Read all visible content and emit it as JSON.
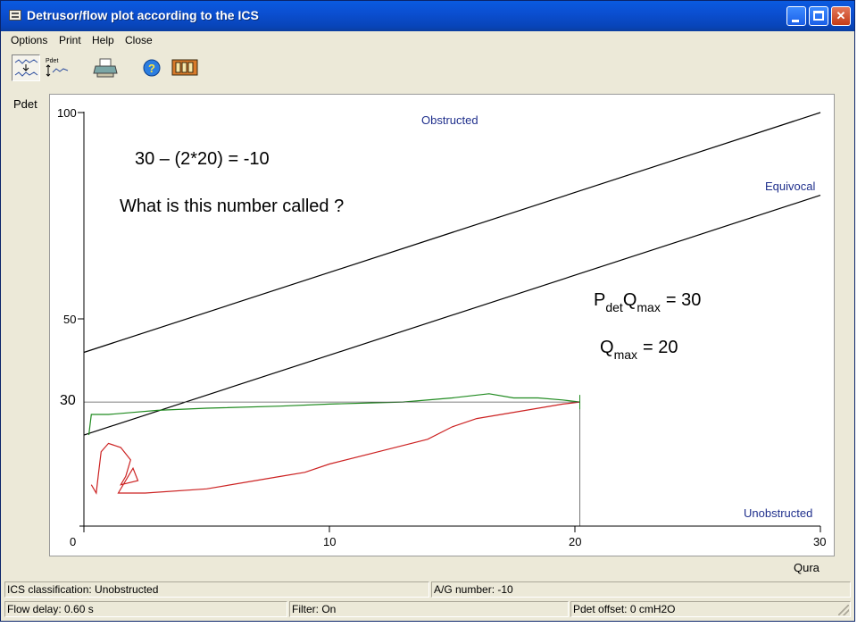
{
  "window": {
    "title": "Detrusor/flow plot according to the ICS"
  },
  "menu": [
    "Options",
    "Print",
    "Help",
    "Close"
  ],
  "toolbar": {
    "tools": [
      "plot-view-icon",
      "pdet-view-icon",
      "printer-icon",
      "help-icon",
      "film-icon"
    ]
  },
  "plot": {
    "y_axis_label": "Pdet",
    "x_axis_label": "Qura",
    "y_ticks": [
      "100",
      "50",
      "30"
    ],
    "x_ticks": [
      "0",
      "10",
      "20",
      "30"
    ],
    "zone_labels": {
      "obstructed": "Obstructed",
      "equivocal": "Equivocal",
      "unobstructed": "Unobstructed"
    },
    "annotations": {
      "formula": "30 – (2*20) = -10",
      "question": "What is this number called ?",
      "pdetqmax_p": "P",
      "pdetqmax_det": "det",
      "pdetqmax_q": "Q",
      "pdetqmax_max": "max",
      "pdetqmax_value": "= 30",
      "qmax_q": "Q",
      "qmax_max": "max",
      "qmax_value": "= 20"
    },
    "colors": {
      "axis": "#000000",
      "boundary_lines": "#000000",
      "zone_label": "#1f2f8c",
      "voiding_curve": "#cc2222",
      "filling_curve": "#1f8a1f"
    }
  },
  "chart_data": {
    "type": "line",
    "xlabel": "Qura",
    "ylabel": "Pdet",
    "xlim": [
      0,
      30
    ],
    "ylim": [
      0,
      100
    ],
    "x_ticks": [
      0,
      10,
      20,
      30
    ],
    "y_ticks": [
      50,
      100
    ],
    "series": [
      {
        "x": [
          0,
          30
        ],
        "y": [
          42,
          100
        ]
      },
      {
        "x": [
          0,
          30
        ],
        "y": [
          22,
          80
        ]
      },
      {
        "x": [
          0.2,
          0.3,
          0.5,
          1,
          2,
          3,
          5,
          8,
          10,
          13,
          15,
          16.5,
          17.5,
          18.5,
          19.5,
          20.2
        ],
        "y": [
          22,
          27,
          27,
          27,
          27.5,
          28,
          28.5,
          29,
          29.5,
          30,
          31,
          32,
          31,
          31,
          30.5,
          30
        ]
      },
      {
        "x": [
          0.3,
          0.5,
          0.6,
          0.7,
          1,
          1.5,
          1.9,
          1.7,
          1.5,
          2.2,
          2.0,
          1.4,
          2.5,
          5,
          8,
          9,
          10,
          12,
          14,
          15,
          16,
          18,
          19.5,
          20.2
        ],
        "y": [
          10,
          8,
          13,
          18,
          20,
          19,
          16,
          12,
          10,
          11,
          14,
          8,
          8,
          9,
          12,
          13,
          15,
          18,
          21,
          24,
          26,
          28,
          29.5,
          30
        ]
      },
      {
        "x": [
          0,
          20.2
        ],
        "y": [
          30,
          30
        ]
      },
      {
        "x": [
          20.2,
          20.2
        ],
        "y": [
          0,
          30
        ]
      }
    ]
  },
  "status": {
    "classification": "ICS classification: Unobstructed",
    "ag_number": "A/G number: -10",
    "flow_delay": "Flow delay: 0.60 s",
    "filter": "Filter: On",
    "pdet_offset": "Pdet offset: 0 cmH2O"
  }
}
